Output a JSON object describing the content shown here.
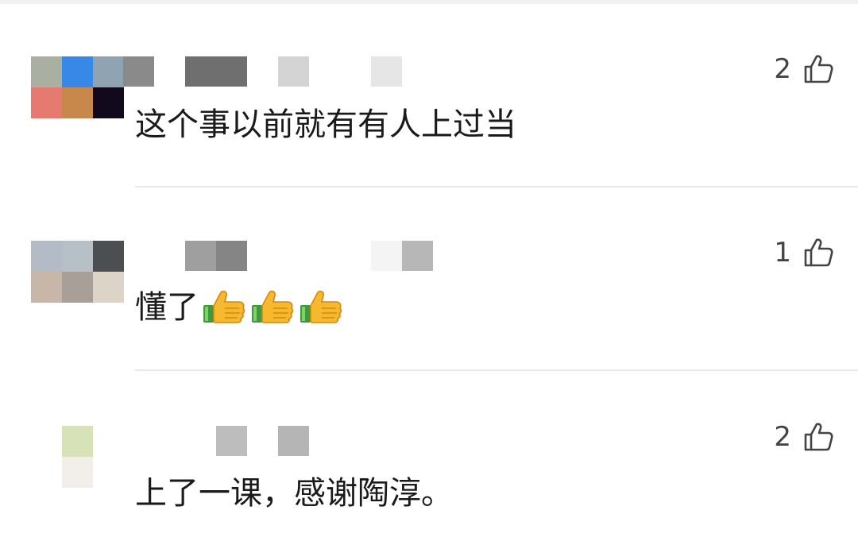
{
  "colors": {
    "text": "#1a1a1a",
    "like_count": "#444444",
    "divider": "#e8e8e8"
  },
  "comments": [
    {
      "text": "这个事以前就有有人上过当",
      "likes": "2",
      "emoji_count": 0,
      "avatar_colors": [
        "#a9afa1",
        "#3888e8",
        "#8fa3b2",
        "#e67a70",
        "#c8884b",
        "#120a1c"
      ],
      "name_colors": [
        "#8a8a8a",
        "#6f6f6f",
        "#6f6f6f",
        "#d4d4d4",
        "#e6e6e6"
      ]
    },
    {
      "text": "懂了",
      "likes": "1",
      "emoji_count": 3,
      "emoji": "thumbs-up-icon",
      "avatar_colors": [
        "#b3bcc6",
        "#b8c0c7",
        "#4c4f52",
        "#c8b7a8",
        "#a89f98",
        "#ddd4c8"
      ],
      "name_colors": [
        "#9f9f9f",
        "#858585",
        "#f4f4f4",
        "#b7b7b7"
      ]
    },
    {
      "text": "上了一课，感谢陶淳。",
      "likes": "2",
      "emoji_count": 0,
      "avatar_colors": [
        "#ffffff",
        "#d7e2b8",
        "#ffffff",
        "#ffffff",
        "#f2eeea",
        "#ffffff"
      ],
      "name_colors": [
        "#bdbdbd",
        "#b5b5b5"
      ]
    }
  ]
}
